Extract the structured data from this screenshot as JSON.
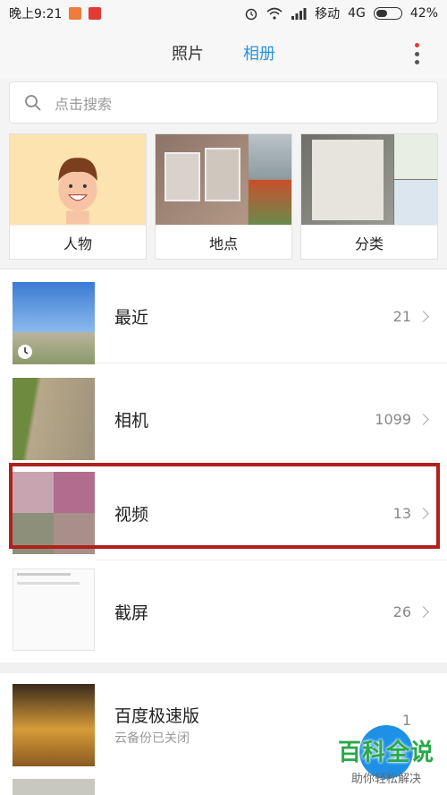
{
  "status_bar": {
    "time": "晚上9:21",
    "carrier": "移动",
    "network": "4G",
    "battery": "42%"
  },
  "tabs": {
    "photos": "照片",
    "albums": "相册",
    "active": "albums"
  },
  "search": {
    "placeholder": "点击搜索"
  },
  "categories": [
    {
      "label": "人物",
      "icon": "person-avatar"
    },
    {
      "label": "地点",
      "icon": "photo-collage"
    },
    {
      "label": "分类",
      "icon": "photo-collage"
    }
  ],
  "albums": [
    {
      "name": "最近",
      "count": "21"
    },
    {
      "name": "相机",
      "count": "1099"
    },
    {
      "name": "视频",
      "count": "13"
    },
    {
      "name": "截屏",
      "count": "26"
    },
    {
      "name": "百度极速版",
      "subtitle": "云备份已关闭",
      "count": "1"
    }
  ],
  "watermark": {
    "title": "百科全说",
    "subtitle": "助你轻松解决"
  },
  "colors": {
    "accent": "#2b93e0",
    "highlight": "#b0201c",
    "watermark_green": "#2aa84a"
  }
}
